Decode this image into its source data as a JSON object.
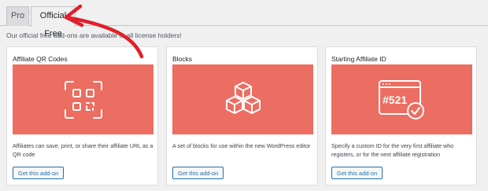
{
  "tabs": [
    {
      "label": "Pro",
      "active": false
    },
    {
      "label": "Official Free",
      "active": true
    }
  ],
  "intro_text": "Our official free add-ons are available to all license holders!",
  "cards": [
    {
      "title": "Affiliate QR Codes",
      "icon": "qr-code-icon",
      "description": "Affiliates can save, print, or share their affiliate URL as a QR code",
      "button_label": "Get this add-on"
    },
    {
      "title": "Blocks",
      "icon": "blocks-icon",
      "description": "A set of blocks for use within the new WordPress editor",
      "button_label": "Get this add-on"
    },
    {
      "title": "Starting Affiliate ID",
      "icon": "browser-id-check-icon",
      "icon_text": "#521",
      "description": "Specify a custom ID for the very first affiliate who registers, or for the next affiliate registration",
      "button_label": "Get this add-on"
    }
  ],
  "colors": {
    "banner": "#ec6d61",
    "button_border": "#2271b1",
    "annotation_arrow": "#e0202a"
  }
}
